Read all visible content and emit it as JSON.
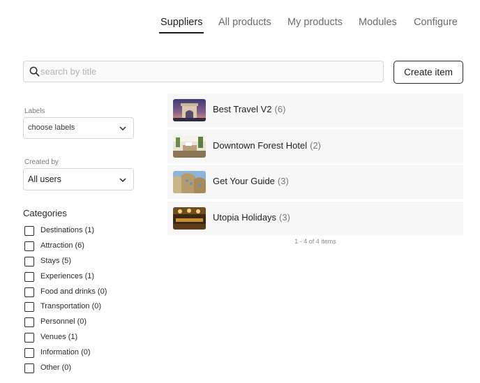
{
  "nav": {
    "tabs": [
      {
        "label": "Suppliers",
        "active": true
      },
      {
        "label": "All products",
        "active": false
      },
      {
        "label": "My products",
        "active": false
      },
      {
        "label": "Modules",
        "active": false
      },
      {
        "label": "Configure",
        "active": false
      }
    ]
  },
  "search": {
    "placeholder": "search by title",
    "value": ""
  },
  "toolbar": {
    "create_label": "Create item"
  },
  "filters": {
    "labels": {
      "label": "Labels",
      "placeholder": "choose labels"
    },
    "created_by": {
      "label": "Created by",
      "value": "All users"
    }
  },
  "categories": {
    "title": "Categories",
    "items": [
      {
        "label": "Destinations (1)",
        "checked": false
      },
      {
        "label": "Attraction (6)",
        "checked": false
      },
      {
        "label": "Stays (5)",
        "checked": false
      },
      {
        "label": "Experiences (1)",
        "checked": false
      },
      {
        "label": "Food and drinks (0)",
        "checked": false
      },
      {
        "label": "Transportation (0)",
        "checked": false
      },
      {
        "label": "Personnel (0)",
        "checked": false
      },
      {
        "label": "Venues (1)",
        "checked": false
      },
      {
        "label": "Information (0)",
        "checked": false
      },
      {
        "label": "Other (0)",
        "checked": false
      }
    ]
  },
  "suppliers": [
    {
      "name": "Best Travel V2",
      "count": "(6)",
      "thumb": "arch-photo"
    },
    {
      "name": "Downtown Forest Hotel",
      "count": "(2)",
      "thumb": "lobby-photo"
    },
    {
      "name": "Get Your Guide",
      "count": "(3)",
      "thumb": "building-photo"
    },
    {
      "name": "Utopia Holidays",
      "count": "(3)",
      "thumb": "hall-photo"
    }
  ],
  "pagination": {
    "summary": "1 - 4 of 4 items"
  }
}
